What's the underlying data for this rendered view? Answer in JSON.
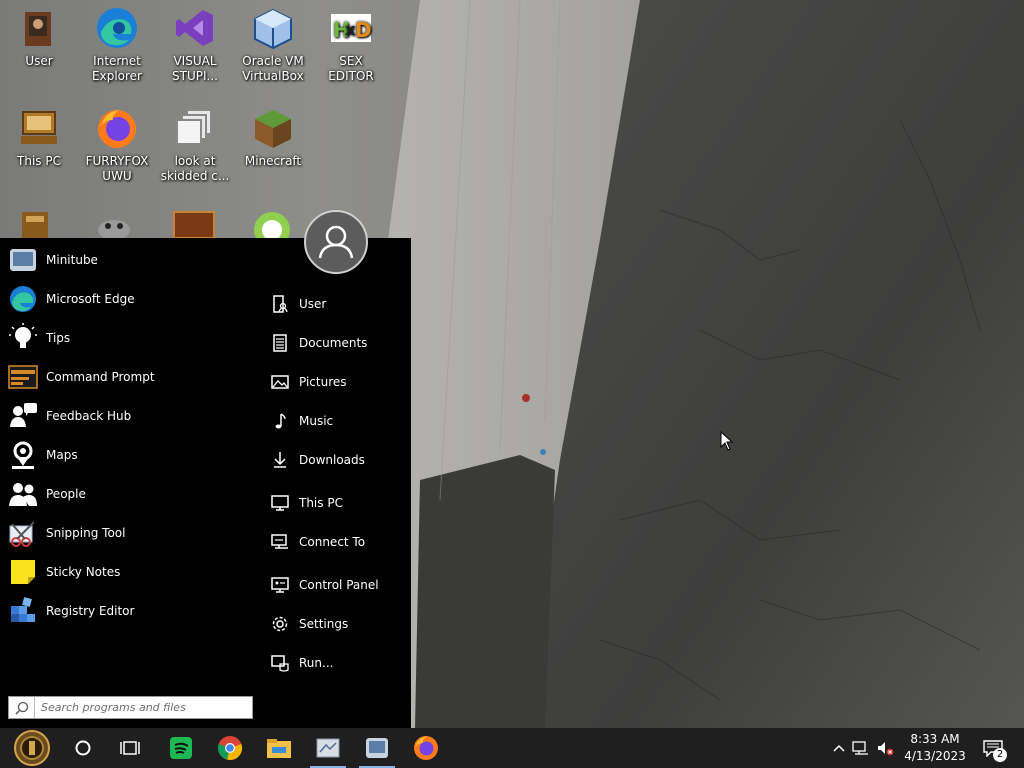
{
  "desktop": {
    "icons": [
      {
        "label": "User",
        "icon": "user-folder-icon"
      },
      {
        "label": "Internet\nExplorer",
        "icon": "edge-icon"
      },
      {
        "label": "VISUAL\nSTUPI...",
        "icon": "visual-studio-icon"
      },
      {
        "label": "Oracle VM\nVirtualBox",
        "icon": "virtualbox-icon"
      },
      {
        "label": "SEX\nEDITOR",
        "icon": "hex-editor-icon"
      },
      {
        "label": "This PC",
        "icon": "computer-icon"
      },
      {
        "label": "FURRYFOX\nUWU",
        "icon": "firefox-icon"
      },
      {
        "label": "look at\nskidded c...",
        "icon": "shortcut-icon"
      },
      {
        "label": "Minecraft",
        "icon": "minecraft-icon"
      }
    ]
  },
  "start_menu": {
    "programs": [
      {
        "label": "Minitube",
        "icon": "minitube-icon"
      },
      {
        "label": "Microsoft Edge",
        "icon": "edge-icon"
      },
      {
        "label": "Tips",
        "icon": "lightbulb-icon"
      },
      {
        "label": "Command Prompt",
        "icon": "command-prompt-icon"
      },
      {
        "label": "Feedback Hub",
        "icon": "feedback-hub-icon"
      },
      {
        "label": "Maps",
        "icon": "maps-icon"
      },
      {
        "label": "People",
        "icon": "people-icon"
      },
      {
        "label": "Snipping Tool",
        "icon": "snipping-tool-icon"
      },
      {
        "label": "Sticky Notes",
        "icon": "sticky-notes-icon"
      },
      {
        "label": "Registry Editor",
        "icon": "registry-editor-icon"
      }
    ],
    "places": [
      {
        "label": "User",
        "icon": "user-icon"
      },
      {
        "label": "Documents",
        "icon": "document-icon"
      },
      {
        "label": "Pictures",
        "icon": "picture-icon"
      },
      {
        "label": "Music",
        "icon": "music-note-icon"
      },
      {
        "label": "Downloads",
        "icon": "download-icon"
      },
      {
        "label": "This PC",
        "icon": "monitor-icon"
      },
      {
        "label": "Connect To",
        "icon": "connect-icon"
      },
      {
        "label": "Control Panel",
        "icon": "control-panel-icon"
      },
      {
        "label": "Settings",
        "icon": "gear-icon"
      },
      {
        "label": "Run...",
        "icon": "run-icon"
      }
    ],
    "search": {
      "placeholder": "Search programs and files",
      "value": ""
    }
  },
  "taskbar": {
    "apps": [
      "start-orb-icon",
      "cortana-icon",
      "task-view-icon",
      "spotify-icon",
      "chrome-icon",
      "file-explorer-icon",
      "app-icon",
      "minitube-icon",
      "firefox-icon"
    ],
    "clock": {
      "time": "8:33 AM",
      "date": "4/13/2023"
    },
    "notification_count": "2"
  },
  "colors": {
    "start_menu_bg": "#000000",
    "taskbar_bg": "#1f1f1f",
    "accent": "#8ab4e8"
  }
}
